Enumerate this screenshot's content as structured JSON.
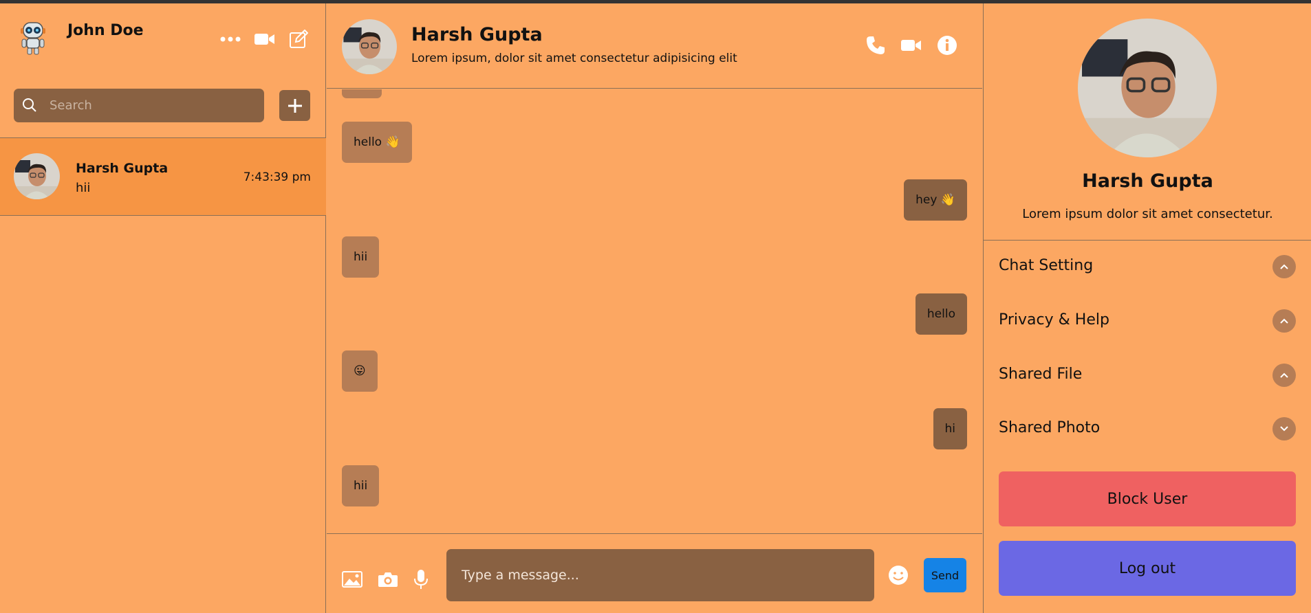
{
  "current_user": {
    "name": "John Doe"
  },
  "search": {
    "placeholder": "Search"
  },
  "chat_list": [
    {
      "name": "Harsh Gupta",
      "last_message": "hii",
      "time": "7:43:39 pm"
    }
  ],
  "chat_header": {
    "name": "Harsh Gupta",
    "status": "Lorem ipsum, dolor sit amet consectetur adipisicing elit"
  },
  "messages": [
    {
      "text": "hello 👋",
      "mine": false
    },
    {
      "text": "hey 👋",
      "mine": true
    },
    {
      "text": "hii",
      "mine": false
    },
    {
      "text": "hello",
      "mine": true
    },
    {
      "text": "😛",
      "mine": false
    },
    {
      "text": "hi",
      "mine": true
    },
    {
      "text": "hii",
      "mine": false
    }
  ],
  "composer": {
    "placeholder": "Type a message...",
    "send_label": "Send"
  },
  "profile": {
    "name": "Harsh Gupta",
    "bio": "Lorem ipsum dolor sit amet consectetur."
  },
  "options": [
    {
      "label": "Chat Setting",
      "state": "up"
    },
    {
      "label": "Privacy & Help",
      "state": "up"
    },
    {
      "label": "Shared File",
      "state": "up"
    },
    {
      "label": "Shared Photo",
      "state": "down"
    }
  ],
  "actions": {
    "block_label": "Block User",
    "logout_label": "Log out"
  },
  "colors": {
    "background": "#fca762",
    "selected_chat": "#f69544",
    "received_bubble": "#b67d55",
    "sent_bubble": "#896142",
    "send_button": "#1583e6",
    "block_button": "#ef6161",
    "logout_button": "#6b68e4"
  }
}
